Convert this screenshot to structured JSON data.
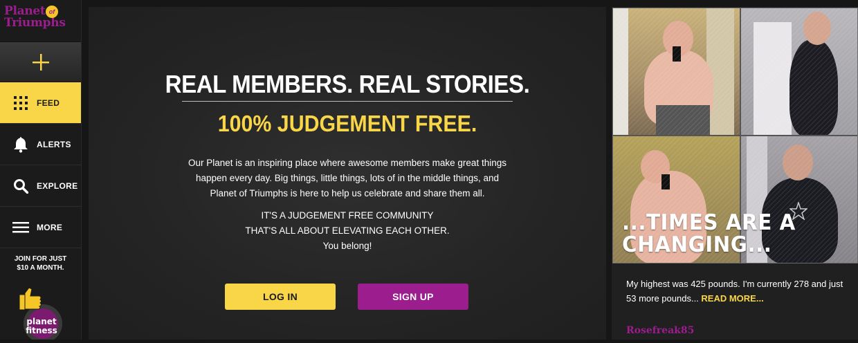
{
  "brand": {
    "logo_line1": "Planet",
    "logo_of": "of",
    "logo_line2": "Triumphs",
    "pf_logo_line1": "planet",
    "pf_logo_line2": "fitness"
  },
  "sidebar": {
    "add_icon": "plus-icon",
    "items": [
      {
        "label": "FEED",
        "icon": "grid-icon",
        "active": true
      },
      {
        "label": "ALERTS",
        "icon": "bell-icon",
        "active": false
      },
      {
        "label": "EXPLORE",
        "icon": "search-icon",
        "active": false
      },
      {
        "label": "MORE",
        "icon": "menu-icon",
        "active": false
      }
    ],
    "join_line1": "JOIN FOR JUST",
    "join_line2": "$10 A MONTH."
  },
  "hero": {
    "headline": "REAL MEMBERS. REAL STORIES.",
    "subhead": "100% JUDGEMENT FREE.",
    "paragraph": "Our Planet is an inspiring place where awesome members make great things happen every day. Big things, little things, lots of in the middle things, and Planet of Triumphs is here to help us celebrate and share them all.",
    "community_line1": "IT'S A JUDGEMENT FREE COMMUNITY",
    "community_line2": "THAT'S ALL ABOUT ELEVATING EACH OTHER.",
    "community_line3": "You belong!",
    "login_label": "LOG IN",
    "signup_label": "SIGN UP"
  },
  "story_card": {
    "overlay_line1": "...TIMES ARE A",
    "overlay_line2": "CHANGING...",
    "text": "My highest was 425 pounds. I'm currently 278 and just 53 more pounds... ",
    "read_more": "READ MORE...",
    "username": "Rosefreak85"
  },
  "colors": {
    "accent_yellow": "#f9d648",
    "brand_purple": "#9b1d8e",
    "background": "#161616"
  }
}
